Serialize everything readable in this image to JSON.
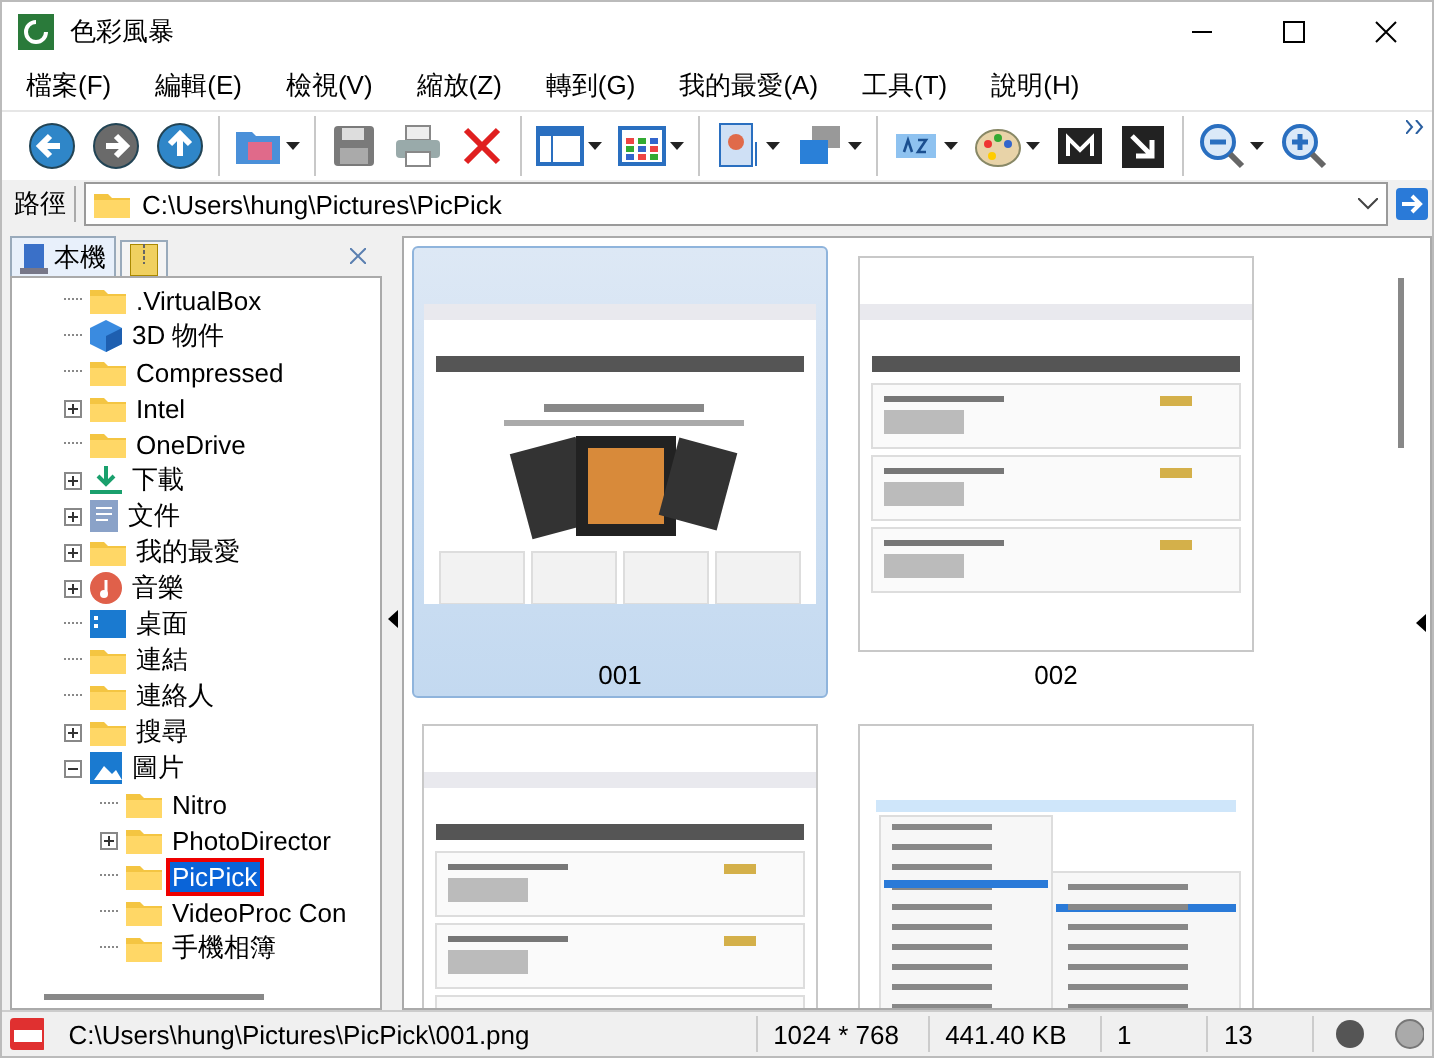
{
  "window": {
    "title": "色彩風暴"
  },
  "menu": [
    "檔案(F)",
    "編輯(E)",
    "檢視(V)",
    "縮放(Z)",
    "轉到(G)",
    "我的最愛(A)",
    "工具(T)",
    "說明(H)"
  ],
  "toolbar_groups": [
    [
      {
        "dropdown": false
      },
      {
        "dropdown": false
      },
      {
        "dropdown": false
      }
    ],
    [
      {
        "dropdown": true
      }
    ],
    [
      {
        "dropdown": false
      },
      {
        "dropdown": false
      },
      {
        "dropdown": false
      }
    ],
    [
      {
        "dropdown": true
      },
      {
        "dropdown": true
      }
    ],
    [
      {
        "dropdown": true
      },
      {
        "dropdown": true
      }
    ],
    [
      {
        "dropdown": true
      },
      {
        "dropdown": true
      },
      {
        "dropdown": false
      },
      {
        "dropdown": false
      }
    ],
    [
      {
        "dropdown": true
      },
      {
        "dropdown": false
      }
    ]
  ],
  "path_bar": {
    "label": "路徑",
    "value": "C:\\Users\\hung\\Pictures\\PicPick"
  },
  "panel_tabs": [
    {
      "label": "本機",
      "selected": true
    },
    {
      "selected": false
    }
  ],
  "tree": [
    {
      "label": ".VirtualBox",
      "kind": "folder",
      "selected": false
    },
    {
      "label": "3D 物件",
      "kind": "cube",
      "selected": false
    },
    {
      "label": "Compressed",
      "kind": "folder",
      "selected": false
    },
    {
      "label": "Intel",
      "kind": "folder",
      "expanded": false,
      "selected": false
    },
    {
      "label": "OneDrive",
      "kind": "folder",
      "selected": false
    },
    {
      "label": "下載",
      "kind": "download",
      "expanded": false,
      "selected": false
    },
    {
      "label": "文件",
      "kind": "document",
      "expanded": false,
      "selected": false
    },
    {
      "label": "我的最愛",
      "kind": "folder",
      "expanded": false,
      "selected": false
    },
    {
      "label": "音樂",
      "kind": "music",
      "expanded": false,
      "selected": false
    },
    {
      "label": "桌面",
      "kind": "desktop",
      "selected": false
    },
    {
      "label": "連結",
      "kind": "folder",
      "selected": false
    },
    {
      "label": "連絡人",
      "kind": "folder",
      "selected": false
    },
    {
      "label": "搜尋",
      "kind": "folder",
      "expanded": false,
      "selected": false
    },
    {
      "label": "圖片",
      "kind": "picture",
      "expanded": true,
      "selected": false,
      "children": [
        {
          "label": "Nitro",
          "kind": "folder",
          "selected": false
        },
        {
          "label": "PhotoDirector",
          "kind": "folder",
          "expanded": false,
          "selected": false
        },
        {
          "label": "PicPick",
          "kind": "folder",
          "selected": true
        },
        {
          "label": "VideoProc Con",
          "kind": "folder",
          "selected": false
        },
        {
          "label": "手機相簿",
          "kind": "folder",
          "selected": false
        }
      ]
    }
  ],
  "thumbnails": [
    {
      "label": "001",
      "selected": true,
      "kind": "webpage"
    },
    {
      "label": "002",
      "selected": false,
      "kind": "list"
    },
    {
      "selected": false,
      "kind": "list"
    },
    {
      "selected": false,
      "kind": "menu"
    }
  ],
  "status_bar": {
    "path": "C:\\Users\\hung\\Pictures\\PicPick\\001.png",
    "dimensions": "1024 * 768",
    "size": "441.40 KB",
    "index": "1",
    "count": "13"
  }
}
